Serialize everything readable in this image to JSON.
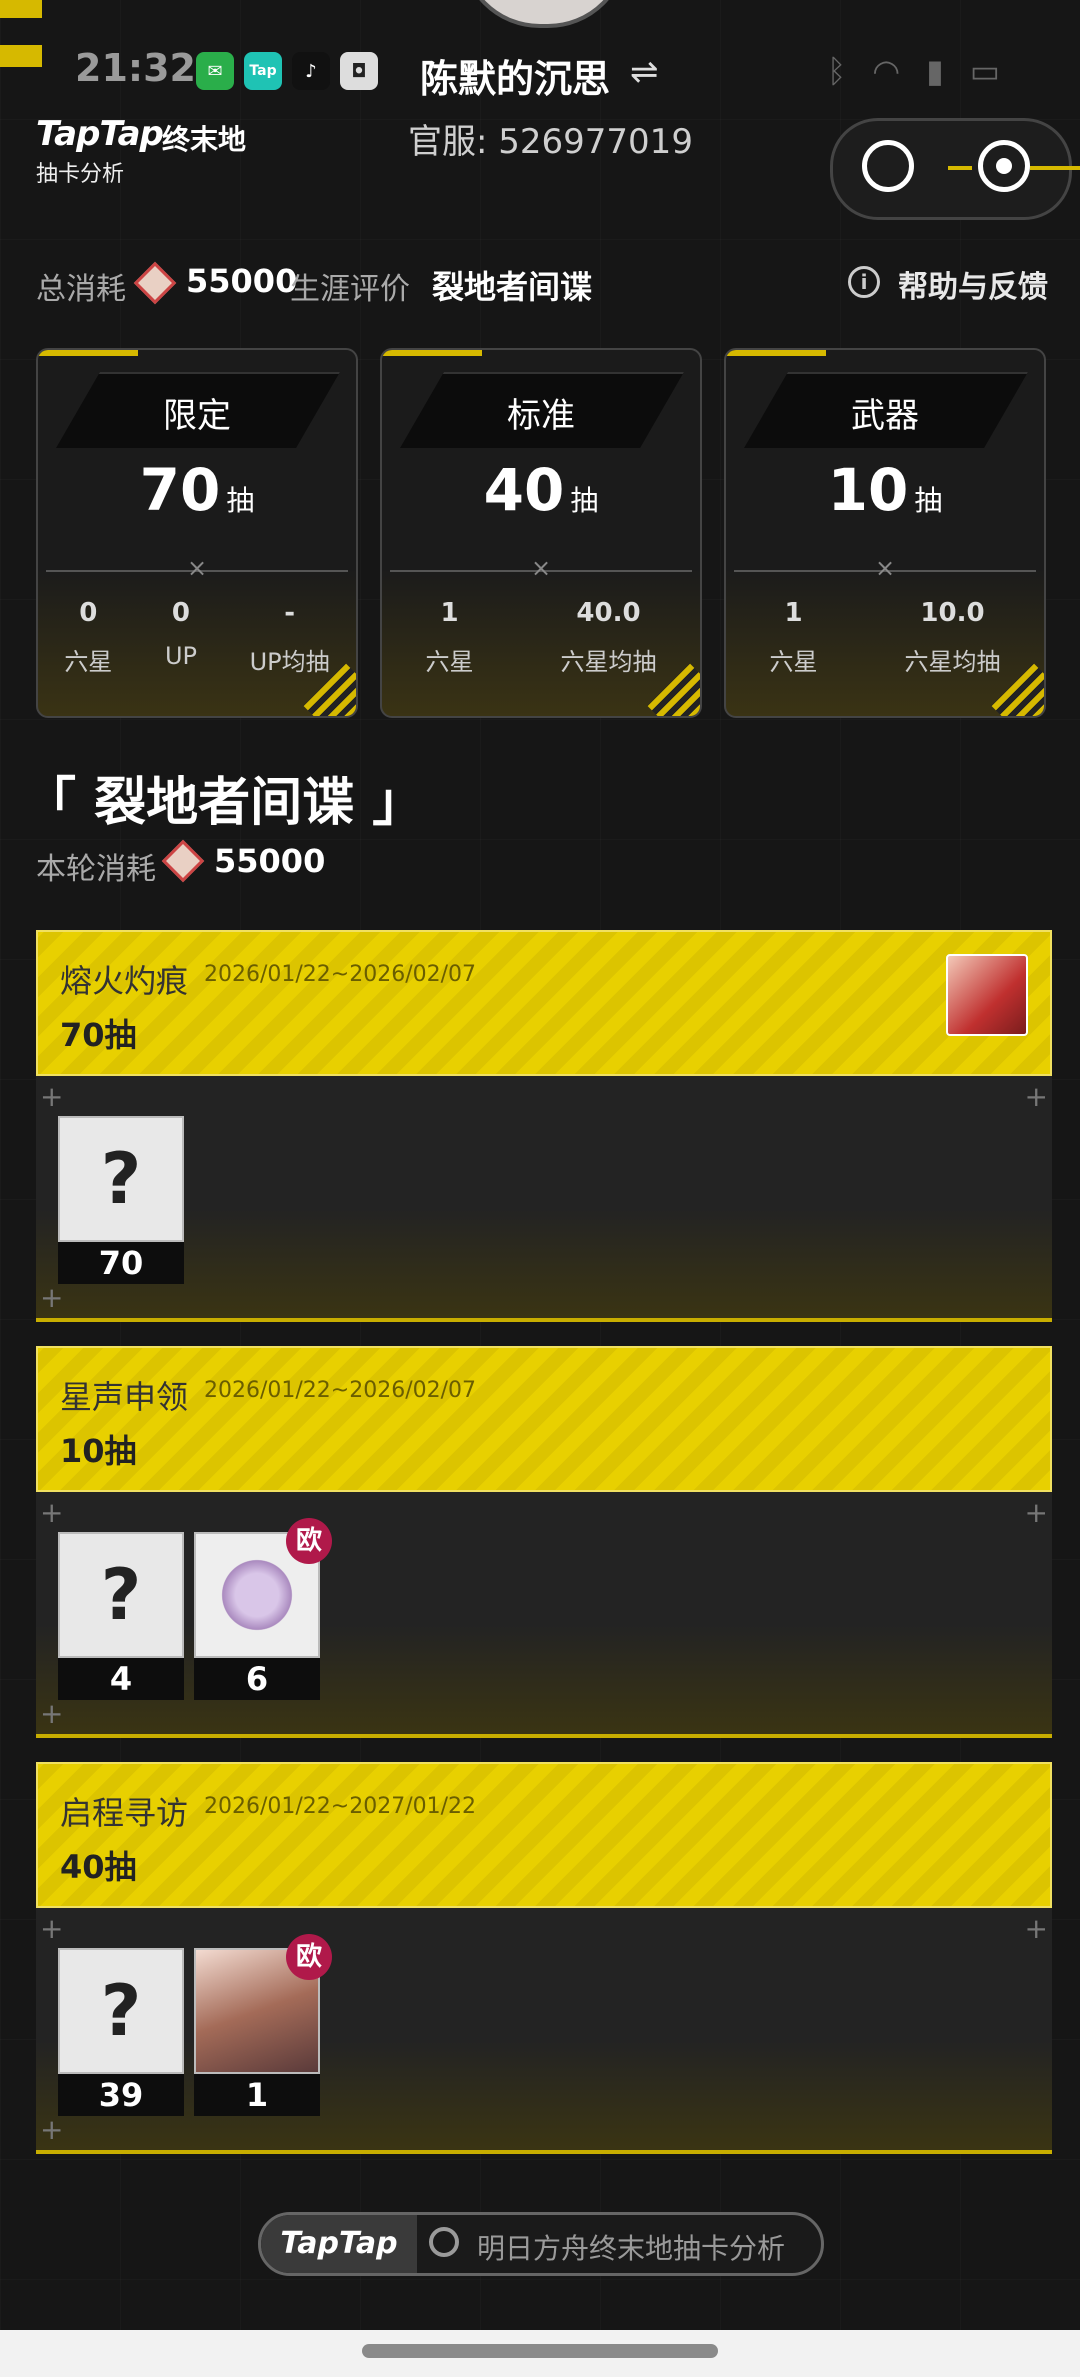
{
  "status_bar": {
    "time": "21:32",
    "icons": [
      "wechat-icon",
      "taptap-icon",
      "tiktok-icon",
      "app-icon"
    ],
    "right_icons": [
      "bluetooth-icon",
      "wifi-icon",
      "signal-icon",
      "battery-icon"
    ]
  },
  "header": {
    "player_name": "陈默的沉思",
    "logo": "TapTap",
    "game_logo": "终末地",
    "logo_sub": "抽卡分析",
    "server_id": "官服: 526977019"
  },
  "summary": {
    "total_cost_label": "总消耗",
    "total_cost_value": "55000",
    "career_label": "生涯评价",
    "career_value": "裂地者间谍",
    "help_label": "帮助与反馈"
  },
  "cards": [
    {
      "title": "限定",
      "count": "70",
      "unit": "抽",
      "stats": [
        {
          "value": "0",
          "label": "六星"
        },
        {
          "value": "0",
          "label": "UP"
        },
        {
          "value": "-",
          "label": "UP均抽"
        }
      ]
    },
    {
      "title": "标准",
      "count": "40",
      "unit": "抽",
      "stats": [
        {
          "value": "1",
          "label": "六星"
        },
        {
          "value": "40.0",
          "label": "六星均抽"
        }
      ]
    },
    {
      "title": "武器",
      "count": "10",
      "unit": "抽",
      "stats": [
        {
          "value": "1",
          "label": "六星"
        },
        {
          "value": "10.0",
          "label": "六星均抽"
        }
      ]
    }
  ],
  "pool": {
    "title": "「 裂地者间谍 」",
    "cost_label": "本轮消耗",
    "cost_value": "55000"
  },
  "banners": [
    {
      "name": "熔火灼痕",
      "date": "2026/01/22~2026/02/07",
      "count": "70抽",
      "items": [
        {
          "type": "unknown",
          "label": "?",
          "count": "70"
        }
      ]
    },
    {
      "name": "星声申领",
      "date": "2026/01/22~2026/02/07",
      "count": "10抽",
      "items": [
        {
          "type": "unknown",
          "label": "?",
          "count": "4"
        },
        {
          "type": "weapon",
          "label": "",
          "count": "6",
          "badge": "欧"
        }
      ]
    },
    {
      "name": "启程寻访",
      "date": "2026/01/22~2027/01/22",
      "count": "40抽",
      "items": [
        {
          "type": "unknown",
          "label": "?",
          "count": "39"
        },
        {
          "type": "char",
          "label": "",
          "count": "1",
          "badge": "欧"
        }
      ]
    }
  ],
  "bottom": {
    "logo": "TapTap",
    "search_text": "明日方舟终末地抽卡分析"
  },
  "colors": {
    "accent": "#d6b900",
    "background": "#161616",
    "badge": "#b0194a"
  }
}
